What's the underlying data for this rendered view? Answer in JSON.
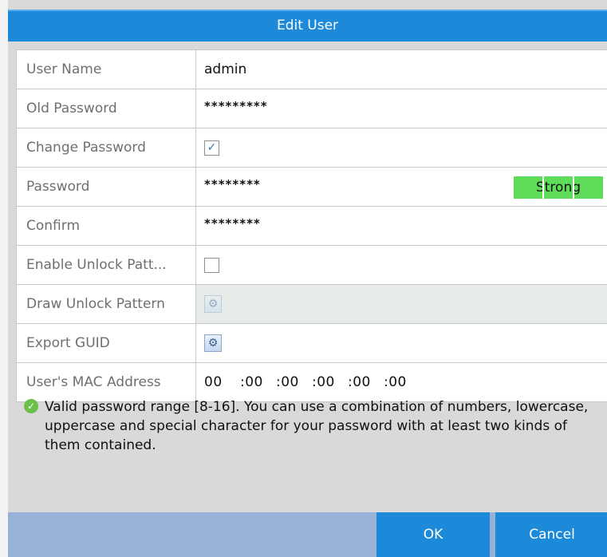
{
  "dialog": {
    "title": "Edit User"
  },
  "form": {
    "user_name": {
      "label": "User Name",
      "value": "admin"
    },
    "old_password": {
      "label": "Old Password",
      "value": "*********"
    },
    "change_password": {
      "label": "Change Password",
      "checked": true,
      "check_glyph": "✓"
    },
    "password": {
      "label": "Password",
      "value": "********",
      "strength": "Strong",
      "strength_color": "#5fdc5a"
    },
    "confirm": {
      "label": "Confirm",
      "value": "********"
    },
    "enable_unlock_pattern": {
      "label": "Enable Unlock Patt...",
      "checked": false
    },
    "draw_unlock_pattern": {
      "label": "Draw Unlock Pattern",
      "icon": "gear-icon",
      "disabled": true
    },
    "export_guid": {
      "label": "Export GUID",
      "icon": "gear-icon"
    },
    "mac_address": {
      "label": "User's MAC Address",
      "segments": [
        "00",
        ":00",
        ":00",
        ":00",
        ":00",
        ":00"
      ]
    }
  },
  "info": {
    "icon": "check-circle-icon",
    "text": "Valid password range [8-16]. You can use a combination of numbers, lowercase, uppercase and special character for your password with at least two kinds of them contained."
  },
  "buttons": {
    "ok": "OK",
    "cancel": "Cancel"
  },
  "colors": {
    "accent": "#1c8ad8",
    "footer": "#98b2d7",
    "background": "#d9d9d9"
  }
}
